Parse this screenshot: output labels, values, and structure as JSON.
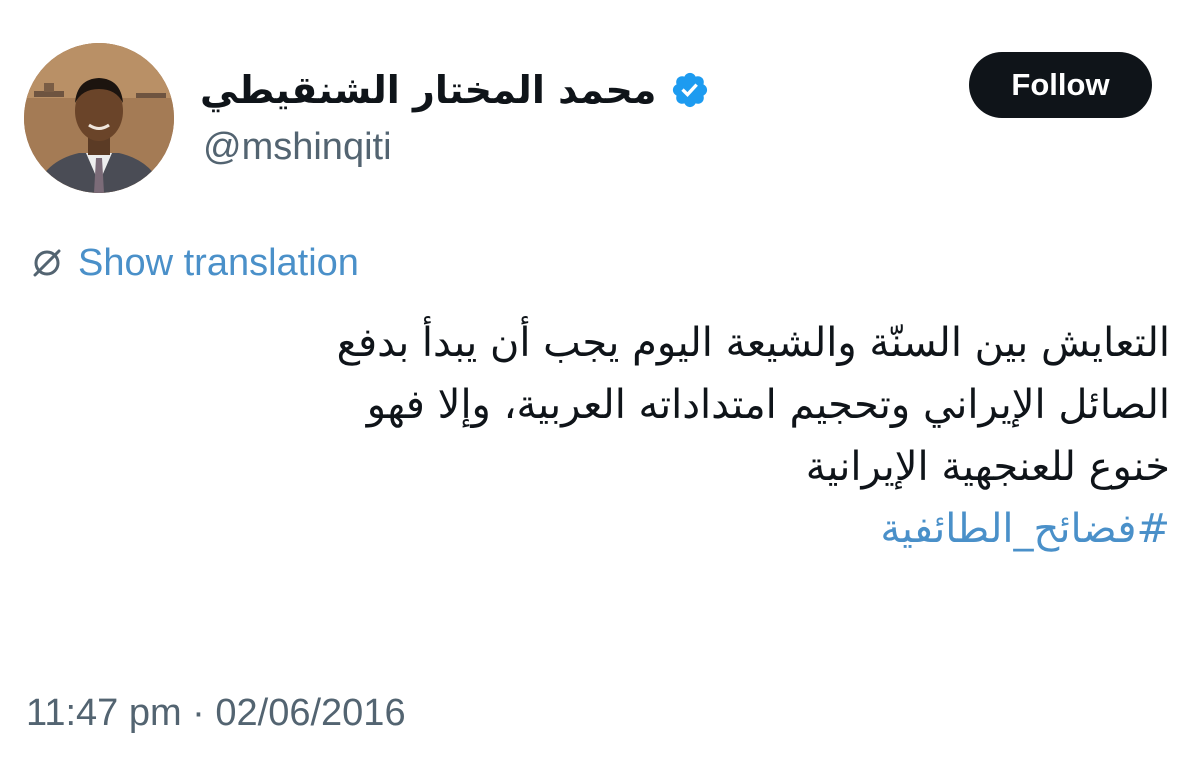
{
  "author": {
    "display_name": "محمد المختار الشنقيطي",
    "handle": "@mshinqiti",
    "verified_icon": "verified-badge-icon",
    "verified_color": "#1d9bf0"
  },
  "follow_button": {
    "label": "Follow",
    "background": "#0f1419",
    "text_color": "#ffffff"
  },
  "translation": {
    "icon": "globe-strikethrough-icon",
    "label": "Show translation",
    "color": "#4a90c9"
  },
  "tweet": {
    "lines": [
      "التعايش بين السنّة والشيعة اليوم يجب أن يبدأ بدفع",
      "الصائل الإيراني وتحجيم امتداداته العربية، وإلا فهو",
      "خنوع للعنجهية الإيرانية"
    ],
    "hashtag": "#فضائح_الطائفية"
  },
  "timestamp": "11:47 pm · 02/06/2016"
}
